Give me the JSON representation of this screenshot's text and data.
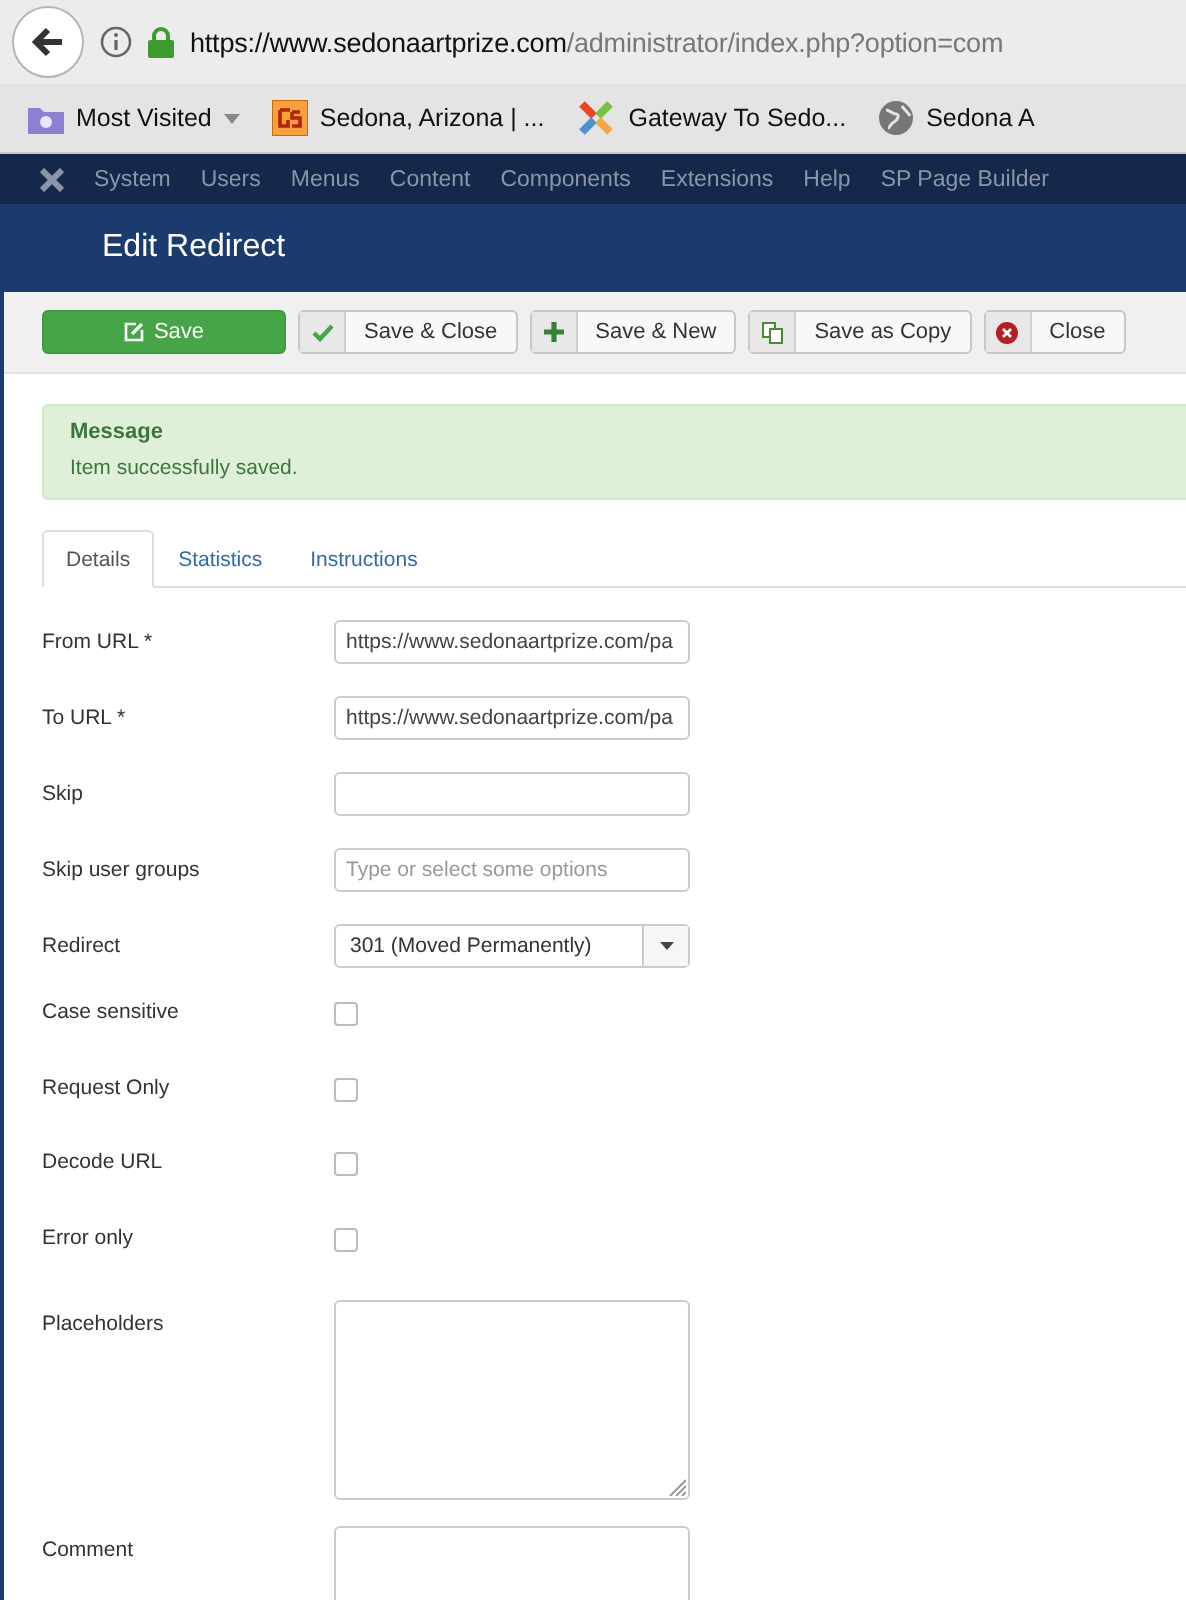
{
  "browser": {
    "url_host": "https://www.sedonaartprize.com",
    "url_path": "/administrator/index.php?option=com",
    "bookmarks": [
      {
        "kind": "folder",
        "label": "Most Visited"
      },
      {
        "kind": "gs",
        "label": "Sedona, Arizona | ..."
      },
      {
        "kind": "joomla",
        "label": "Gateway To Sedo..."
      },
      {
        "kind": "globe",
        "label": "Sedona A"
      }
    ]
  },
  "menu": [
    "System",
    "Users",
    "Menus",
    "Content",
    "Components",
    "Extensions",
    "Help",
    "SP Page Builder"
  ],
  "page_title": "Edit Redirect",
  "toolbar": [
    {
      "kind": "save",
      "label": "Save"
    },
    {
      "kind": "check",
      "label": "Save & Close"
    },
    {
      "kind": "plus",
      "label": "Save & New"
    },
    {
      "kind": "copy",
      "label": "Save as Copy"
    },
    {
      "kind": "close",
      "label": "Close"
    }
  ],
  "message": {
    "heading": "Message",
    "text": "Item successfully saved."
  },
  "tabs": [
    {
      "label": "Details",
      "selected": true
    },
    {
      "label": "Statistics",
      "selected": false
    },
    {
      "label": "Instructions",
      "selected": false
    }
  ],
  "fields": [
    {
      "kind": "text",
      "label": "From URL *",
      "value": "https://www.sedonaartprize.com/pa"
    },
    {
      "kind": "text",
      "label": "To URL *",
      "value": "https://www.sedonaartprize.com/pa"
    },
    {
      "kind": "text",
      "label": "Skip"
    },
    {
      "kind": "text",
      "label": "Skip user groups",
      "placeholder": "Type or select some options"
    },
    {
      "kind": "select",
      "label": "Redirect",
      "value": "301 (Moved Permanently)"
    },
    {
      "kind": "checkbox",
      "label": "Case sensitive",
      "checked": false
    },
    {
      "kind": "checkbox",
      "label": "Request Only",
      "checked": false
    },
    {
      "kind": "checkbox",
      "label": "Decode URL",
      "checked": false
    },
    {
      "kind": "checkbox",
      "label": "Error only",
      "checked": false
    },
    {
      "kind": "textarea",
      "label": "Placeholders"
    },
    {
      "kind": "textarea",
      "label": "Comment"
    }
  ]
}
